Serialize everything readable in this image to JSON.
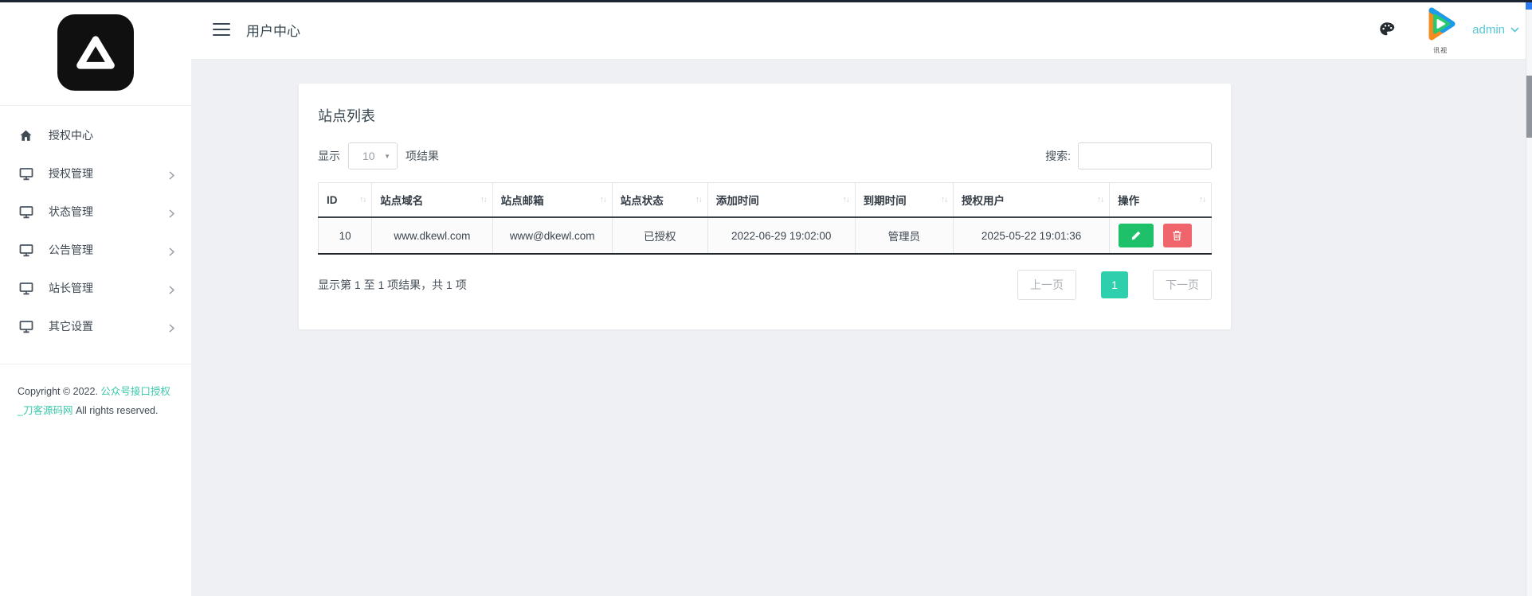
{
  "topbar": {
    "title": "用户中心",
    "user_label": "admin",
    "avatar_caption": "讯视"
  },
  "sidebar": {
    "items": [
      {
        "label": "授权中心",
        "icon": "home-icon",
        "has_submenu": false
      },
      {
        "label": "授权管理",
        "icon": "monitor-icon",
        "has_submenu": true
      },
      {
        "label": "状态管理",
        "icon": "monitor-icon",
        "has_submenu": true
      },
      {
        "label": "公告管理",
        "icon": "monitor-icon",
        "has_submenu": true
      },
      {
        "label": "站长管理",
        "icon": "monitor-icon",
        "has_submenu": true
      },
      {
        "label": "其它设置",
        "icon": "monitor-icon",
        "has_submenu": true
      }
    ],
    "copyright_prefix": "Copyright © 2022.",
    "copyright_link": "公众号接口授权_刀客源码网",
    "copyright_suffix": "All rights reserved."
  },
  "panel": {
    "title": "站点列表",
    "length_prefix": "显示",
    "length_value": "10",
    "length_suffix": "项结果",
    "search_label": "搜索:",
    "search_value": "",
    "sort_icon": "↑↓",
    "select_caret": "▼",
    "table": {
      "columns": [
        "ID",
        "站点域名",
        "站点邮箱",
        "站点状态",
        "添加时间",
        "到期时间",
        "授权用户",
        "操作"
      ],
      "rows": [
        {
          "cells": [
            "10",
            "www.dkewl.com",
            "www@dkewl.com",
            "已授权",
            "2022-06-29 19:02:00",
            "管理员",
            "2025-05-22 19:01:36"
          ]
        }
      ]
    },
    "info": "显示第 1 至 1 项结果，共 1 项",
    "pagination": {
      "prev": "上一页",
      "current": "1",
      "next": "下一页"
    }
  },
  "colors": {
    "accent_teal": "#2ecfad",
    "link_teal": "#3cc8aa",
    "admin_teal": "#56c8d4",
    "edit_green": "#1fc06a",
    "delete_red": "#f0646c",
    "scrollbar_blue": "#2f7df6",
    "header_border_dark": "#3e444b"
  }
}
